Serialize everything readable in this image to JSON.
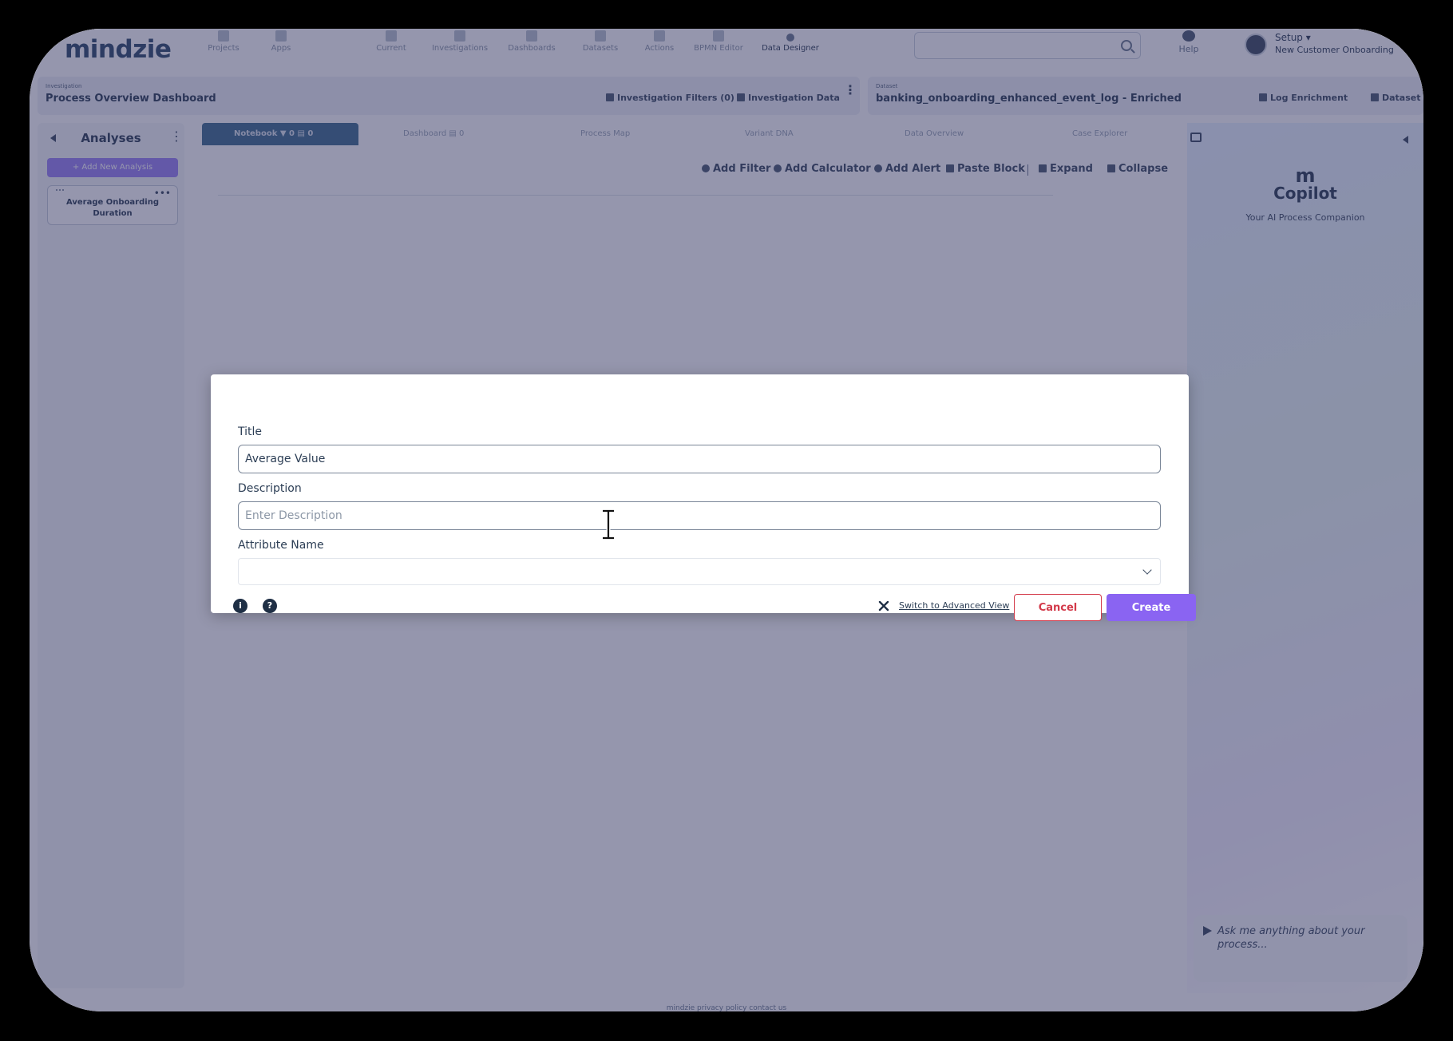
{
  "app": {
    "logo": "mindzie",
    "nav": [
      {
        "label": "Projects",
        "icon": "file-icon"
      },
      {
        "label": "Apps",
        "icon": "apps-icon"
      },
      {
        "label": "Current",
        "icon": "pin-icon"
      },
      {
        "label": "Investigations",
        "icon": "pie-icon"
      },
      {
        "label": "Dashboards",
        "icon": "grid-icon"
      },
      {
        "label": "Datasets",
        "icon": "database-icon"
      },
      {
        "label": "Actions",
        "icon": "actions-icon"
      },
      {
        "label": "BPMN Editor",
        "icon": "bpmn-icon"
      },
      {
        "label": "Data Designer",
        "icon": "designer-icon"
      }
    ],
    "help_label": "Help",
    "user": {
      "name": "Setup ▾",
      "subtitle": "New Customer Onboarding"
    }
  },
  "context": {
    "investigation_label": "Investigation",
    "investigation_title": "Process Overview Dashboard",
    "filters_label": "Investigation Filters (0)",
    "data_label": "Investigation Data",
    "dataset_label": "Dataset",
    "dataset_title": "banking_onboarding_enhanced_event_log - Enriched",
    "log_enrichment_label": "Log Enrichment",
    "dataset_button_label": "Dataset"
  },
  "sidebar": {
    "title": "Analyses",
    "add_label": "+ Add New Analysis",
    "analyses": [
      {
        "label": "Average Onboarding Duration"
      }
    ]
  },
  "tabs": [
    {
      "label": "Notebook   ▼ 0  ▤ 0"
    },
    {
      "label": "Dashboard   ▤ 0"
    },
    {
      "label": "Process Map"
    },
    {
      "label": "Variant DNA"
    },
    {
      "label": "Data Overview"
    },
    {
      "label": "Case Explorer"
    }
  ],
  "toolbar": {
    "add_filter": "Add Filter",
    "add_calculator": "Add Calculator",
    "add_alert": "Add Alert",
    "paste_block": "Paste Block",
    "expand": "Expand",
    "collapse": "Collapse"
  },
  "copilot": {
    "mark": "m",
    "title": "Copilot",
    "subtitle": "Your AI Process Companion",
    "placeholder": "Ask me anything about your process..."
  },
  "footer": "mindzie     privacy policy     contact us",
  "modal": {
    "title_label": "Title",
    "title_value": "Average Value",
    "description_label": "Description",
    "description_placeholder": "Enter Description",
    "attribute_label": "Attribute Name",
    "attribute_value": "",
    "advanced_link": "Switch to Advanced View",
    "cancel_label": "Cancel",
    "create_label": "Create",
    "info_glyph": "i",
    "help_glyph": "?"
  },
  "colors": {
    "accent": "#8a64f2",
    "cancel": "#d33a4a",
    "overlay": "#2c2e5c"
  }
}
